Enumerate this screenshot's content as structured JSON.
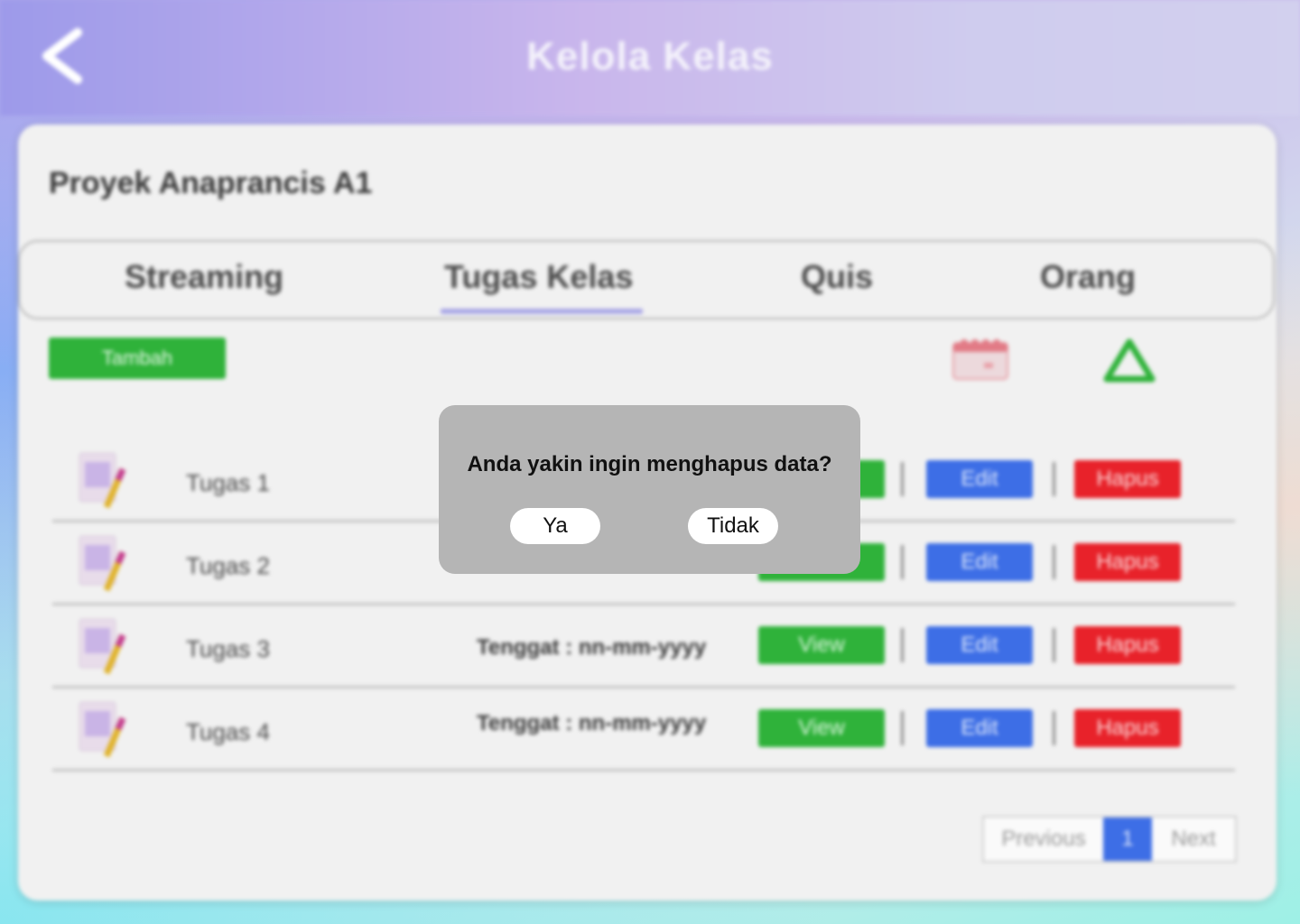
{
  "header": {
    "title": "Kelola Kelas"
  },
  "course": {
    "name": "Proyek Anaprancis A1"
  },
  "tabs": [
    {
      "label": "Streaming"
    },
    {
      "label": "Tugas Kelas",
      "active": true
    },
    {
      "label": "Quis"
    },
    {
      "label": "Orang"
    }
  ],
  "toolbar": {
    "add_label": "Tambah"
  },
  "tasks": [
    {
      "name": "Tugas 1",
      "deadline": "",
      "view": "View",
      "edit": "Edit",
      "delete": "Hapus"
    },
    {
      "name": "Tugas 2",
      "deadline": "",
      "view": "View",
      "edit": "Edit",
      "delete": "Hapus"
    },
    {
      "name": "Tugas 3",
      "deadline": "Tenggat : nn-mm-yyyy",
      "view": "View",
      "edit": "Edit",
      "delete": "Hapus"
    },
    {
      "name": "Tugas 4",
      "deadline": "Tenggat : nn-mm-yyyy",
      "view": "View",
      "edit": "Edit",
      "delete": "Hapus"
    }
  ],
  "pagination": {
    "previous": "Previous",
    "current": "1",
    "next": "Next"
  },
  "dialog": {
    "message": "Anda yakin ingin menghapus data?",
    "confirm": "Ya",
    "cancel": "Tidak"
  },
  "colors": {
    "primary_green": "#2fb23a",
    "edit_blue": "#3d6ee6",
    "delete_red": "#e8222a",
    "tab_accent": "#a9a7e6"
  }
}
